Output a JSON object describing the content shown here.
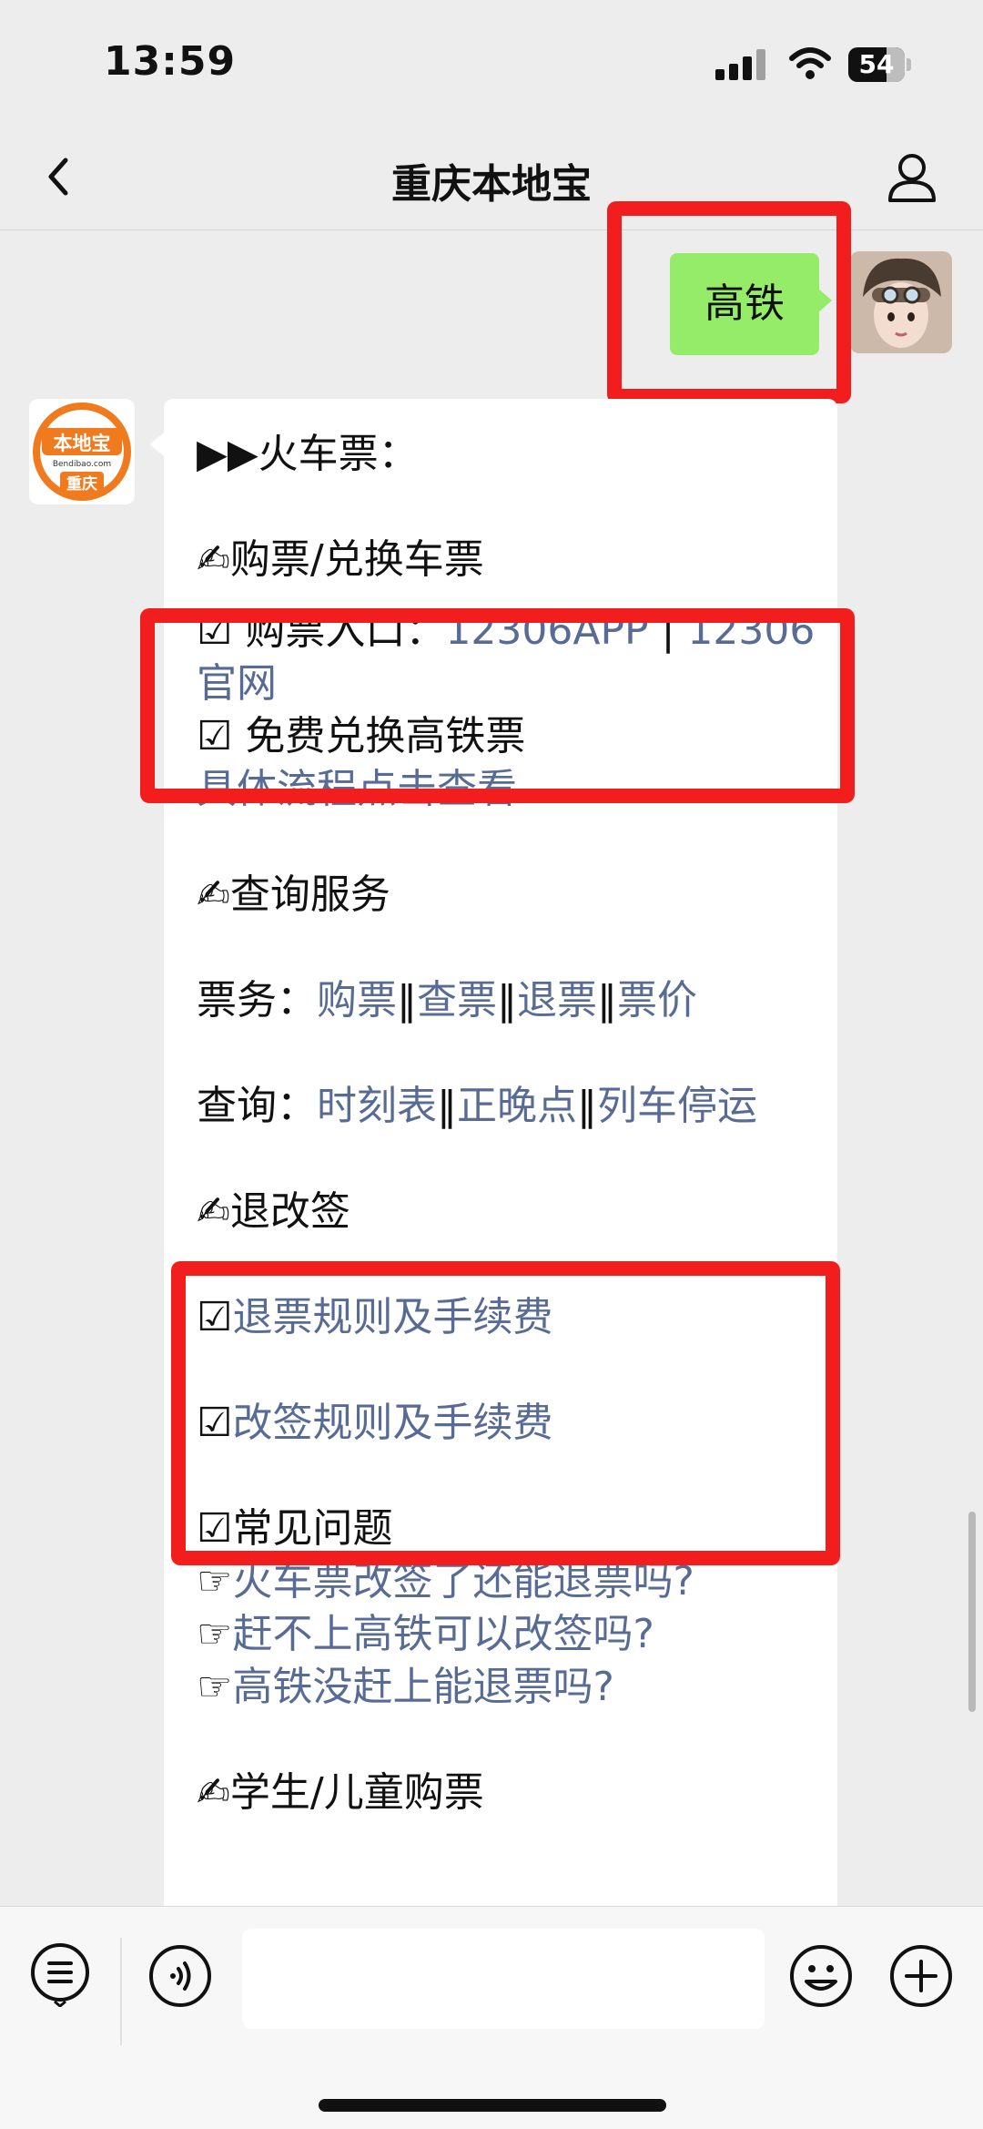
{
  "status_bar": {
    "time": "13:59",
    "battery": "54"
  },
  "nav": {
    "title": "重庆本地宝",
    "back_icon": "chevron-left-icon",
    "profile_icon": "person-icon"
  },
  "chat": {
    "sent_message": "高铁",
    "brand_avatar": {
      "top_text": "本地宝",
      "domain": "Bendibao.com",
      "bottom_text": "重庆"
    },
    "reply": {
      "heading": "▶▶火车票：",
      "section1_title": "✍购票/兑换车票",
      "buy_label": "☑ 购票入口：",
      "buy_link1": "12306APP",
      "buy_sep": " | ",
      "buy_link2_line1": "12306",
      "buy_link2_line2": "官网",
      "free_label": "☑ 免费兑换高铁票",
      "free_link": "具体流程点击查看",
      "section2_title": "✍查询服务",
      "ticket_label": "票务：",
      "ticket_links": [
        "购票",
        "查票",
        "退票",
        "票价"
      ],
      "query_label": "查询：",
      "query_links": [
        "时刻表",
        "正晚点",
        "列车停运"
      ],
      "link_sep": "‖",
      "section3_title": "✍退改签",
      "refund_check": "☑",
      "refund_link": "退票规则及手续费",
      "change_check": "☑",
      "change_link": "改签规则及手续费",
      "faq_title": "☑常见问题",
      "faq_pointer": "☞",
      "faq_links": [
        "火车票改签了还能退票吗?",
        "赶不上高铁可以改签吗?",
        "高铁没赶上能退票吗?"
      ],
      "section4_title": "✍学生/儿童购票"
    }
  },
  "bottom_bar": {
    "menu_icon": "menu-list-icon",
    "voice_icon": "voice-icon",
    "emoji_icon": "emoji-icon",
    "plus_icon": "plus-icon",
    "input_value": ""
  },
  "colors": {
    "accent_link": "#576b95",
    "sent_bubble": "#95ec69",
    "highlight": "#f21e1e"
  }
}
